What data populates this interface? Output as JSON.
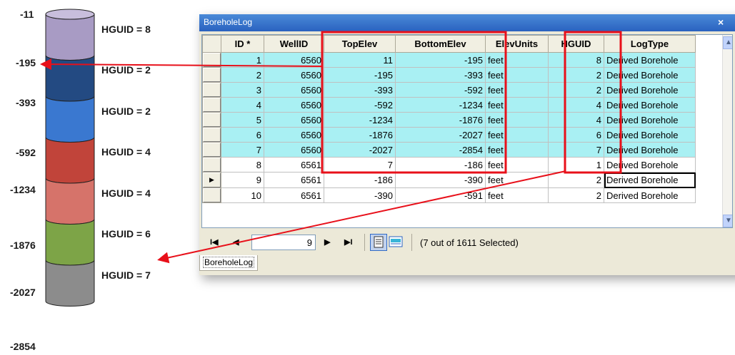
{
  "borehole": {
    "elevations": [
      "-11",
      "-195",
      "-393",
      "-592",
      "-1234",
      "-1876",
      "-2027",
      "-2854"
    ],
    "layers": [
      {
        "label": "HGUID = 8",
        "color": "#a89bc4"
      },
      {
        "label": "HGUID = 2",
        "color": "#234a82"
      },
      {
        "label": "HGUID = 2",
        "color": "#3a78d0"
      },
      {
        "label": "HGUID = 4",
        "color": "#c1443a"
      },
      {
        "label": "HGUID = 4",
        "color": "#d6736a"
      },
      {
        "label": "HGUID = 6",
        "color": "#7da447"
      },
      {
        "label": "HGUID = 7",
        "color": "#8c8c8c"
      }
    ]
  },
  "window": {
    "title": "BoreholeLog",
    "close_glyph": "×",
    "columns": [
      "ID *",
      "WellID",
      "TopElev",
      "BottomElev",
      "ElevUnits",
      "HGUID",
      "LogType"
    ],
    "rows": [
      {
        "selected": true,
        "current": false,
        "cells": [
          "1",
          "6560",
          "11",
          "-195",
          "feet",
          "8",
          "Derived Borehole"
        ]
      },
      {
        "selected": true,
        "current": false,
        "cells": [
          "2",
          "6560",
          "-195",
          "-393",
          "feet",
          "2",
          "Derived Borehole"
        ]
      },
      {
        "selected": true,
        "current": false,
        "cells": [
          "3",
          "6560",
          "-393",
          "-592",
          "feet",
          "2",
          "Derived Borehole"
        ]
      },
      {
        "selected": true,
        "current": false,
        "cells": [
          "4",
          "6560",
          "-592",
          "-1234",
          "feet",
          "4",
          "Derived Borehole"
        ]
      },
      {
        "selected": true,
        "current": false,
        "cells": [
          "5",
          "6560",
          "-1234",
          "-1876",
          "feet",
          "4",
          "Derived Borehole"
        ]
      },
      {
        "selected": true,
        "current": false,
        "cells": [
          "6",
          "6560",
          "-1876",
          "-2027",
          "feet",
          "6",
          "Derived Borehole"
        ]
      },
      {
        "selected": true,
        "current": false,
        "cells": [
          "7",
          "6560",
          "-2027",
          "-2854",
          "feet",
          "7",
          "Derived Borehole"
        ]
      },
      {
        "selected": false,
        "current": false,
        "cells": [
          "8",
          "6561",
          "7",
          "-186",
          "feet",
          "1",
          "Derived Borehole"
        ]
      },
      {
        "selected": false,
        "current": true,
        "cells": [
          "9",
          "6561",
          "-186",
          "-390",
          "feet",
          "2",
          "Derived Borehole"
        ]
      },
      {
        "selected": false,
        "current": false,
        "cells": [
          "10",
          "6561",
          "-390",
          "-591",
          "feet",
          "2",
          "Derived Borehole"
        ]
      }
    ],
    "nav": {
      "first": "I◀",
      "prev": "◀",
      "record": "9",
      "next": "▶",
      "last": "▶I",
      "status": "(7 out of 1611 Selected)"
    },
    "tab_label": "BoreholeLog",
    "selected_fill": "#a9f0f3",
    "highlight_color": "#e8101a"
  }
}
